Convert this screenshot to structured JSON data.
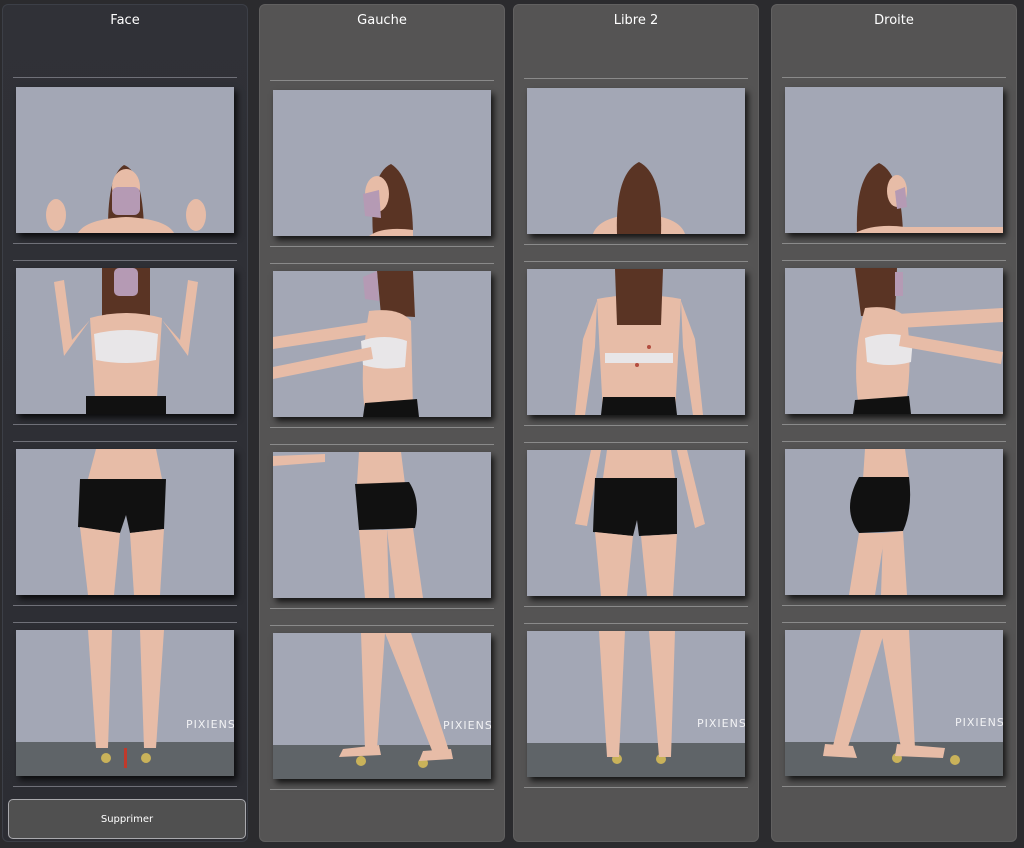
{
  "columns": [
    {
      "id": "face",
      "title": "Face",
      "active": true
    },
    {
      "id": "gauche",
      "title": "Gauche",
      "active": false
    },
    {
      "id": "libre2",
      "title": "Libre 2",
      "active": false
    },
    {
      "id": "droite",
      "title": "Droite",
      "active": false
    }
  ],
  "photo_rows": [
    "upper-body-hands",
    "torso",
    "hips-thighs",
    "legs-feet"
  ],
  "watermark": "PIXIENS",
  "delete_button_label": "Supprimer",
  "colors": {
    "backdrop": "#a3a7b5",
    "skin": "#e7bca7",
    "hair": "#5a3424",
    "underwear": "#111111",
    "bra": "#e8e6e8",
    "mask": "#b59ab4",
    "mat": "#5f6468"
  }
}
